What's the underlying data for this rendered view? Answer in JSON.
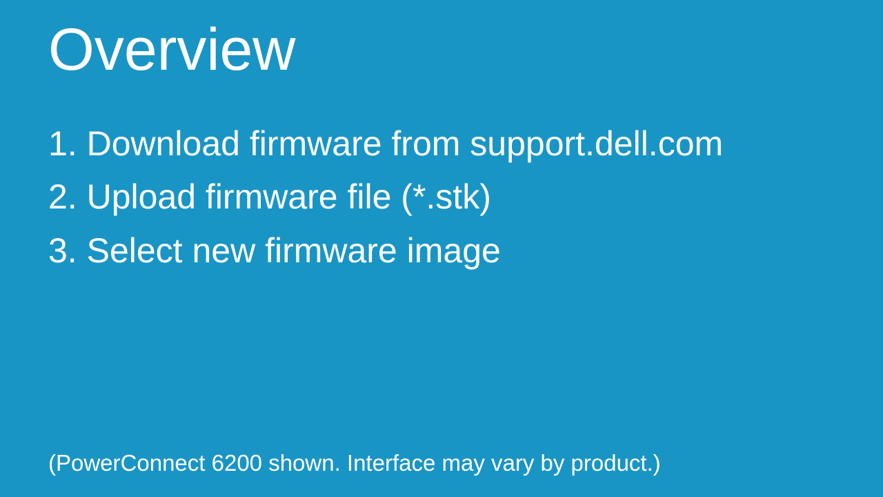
{
  "title": "Overview",
  "steps": [
    "1. Download firmware from support.dell.com",
    "2. Upload firmware file (*.stk)",
    "3. Select new firmware image"
  ],
  "footnote": "(PowerConnect 6200 shown. Interface may vary by product.)"
}
